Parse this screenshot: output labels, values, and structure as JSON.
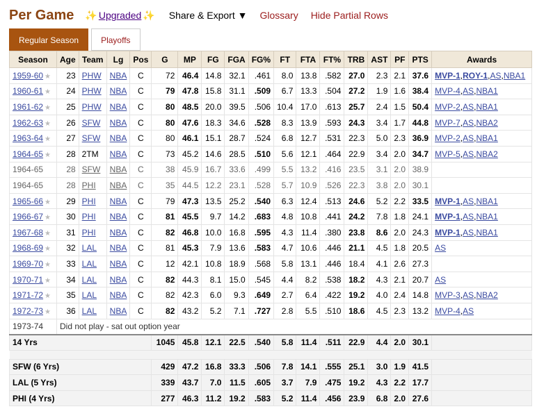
{
  "header": {
    "title": "Per Game",
    "upgraded": "Upgraded",
    "share_export": "Share & Export ▼",
    "glossary": "Glossary",
    "hide_partial": "Hide Partial Rows"
  },
  "tabs": [
    {
      "label": "Regular Season",
      "active": true
    },
    {
      "label": "Playoffs",
      "active": false
    }
  ],
  "columns": [
    "Season",
    "Age",
    "Team",
    "Lg",
    "Pos",
    "G",
    "MP",
    "FG",
    "FGA",
    "FG%",
    "FT",
    "FTA",
    "FT%",
    "TRB",
    "AST",
    "PF",
    "PTS",
    "Awards"
  ],
  "rows": [
    {
      "season": "1959-60",
      "age": "23",
      "team": "PHW",
      "team_link": true,
      "lg": "NBA",
      "pos": "C",
      "g": "72",
      "mp": "46.4",
      "fg": "14.8",
      "fga": "32.1",
      "fgp": "0.461",
      "ft": "8.0",
      "fta": "13.8",
      "ftp": "0.582",
      "trb": "27.0",
      "ast": "2.3",
      "pf": "2.1",
      "pts": "37.6",
      "bold": [
        "mp",
        "trb",
        "pts"
      ],
      "awards": [
        {
          "t": "MVP-1",
          "b": true
        },
        {
          "t": "ROY-1",
          "b": true
        },
        {
          "t": "AS"
        },
        {
          "t": "NBA1"
        }
      ]
    },
    {
      "season": "1960-61",
      "age": "24",
      "team": "PHW",
      "team_link": true,
      "lg": "NBA",
      "pos": "C",
      "g": "79",
      "mp": "47.8",
      "fg": "15.8",
      "fga": "31.1",
      "fgp": "0.509",
      "ft": "6.7",
      "fta": "13.3",
      "ftp": "0.504",
      "trb": "27.2",
      "ast": "1.9",
      "pf": "1.6",
      "pts": "38.4",
      "bold": [
        "g",
        "mp",
        "fgp",
        "trb",
        "pts"
      ],
      "awards": [
        {
          "t": "MVP-4"
        },
        {
          "t": "AS"
        },
        {
          "t": "NBA1"
        }
      ]
    },
    {
      "season": "1961-62",
      "age": "25",
      "team": "PHW",
      "team_link": true,
      "lg": "NBA",
      "pos": "C",
      "g": "80",
      "mp": "48.5",
      "fg": "20.0",
      "fga": "39.5",
      "fgp": "0.506",
      "ft": "10.4",
      "fta": "17.0",
      "ftp": "0.613",
      "trb": "25.7",
      "ast": "2.4",
      "pf": "1.5",
      "pts": "50.4",
      "bold": [
        "g",
        "mp",
        "trb",
        "pts"
      ],
      "awards": [
        {
          "t": "MVP-2"
        },
        {
          "t": "AS"
        },
        {
          "t": "NBA1"
        }
      ]
    },
    {
      "season": "1962-63",
      "age": "26",
      "team": "SFW",
      "team_link": true,
      "lg": "NBA",
      "pos": "C",
      "g": "80",
      "mp": "47.6",
      "fg": "18.3",
      "fga": "34.6",
      "fgp": "0.528",
      "ft": "8.3",
      "fta": "13.9",
      "ftp": "0.593",
      "trb": "24.3",
      "ast": "3.4",
      "pf": "1.7",
      "pts": "44.8",
      "bold": [
        "g",
        "mp",
        "fgp",
        "trb",
        "pts"
      ],
      "awards": [
        {
          "t": "MVP-7"
        },
        {
          "t": "AS"
        },
        {
          "t": "NBA2"
        }
      ]
    },
    {
      "season": "1963-64",
      "age": "27",
      "team": "SFW",
      "team_link": true,
      "lg": "NBA",
      "pos": "C",
      "g": "80",
      "mp": "46.1",
      "fg": "15.1",
      "fga": "28.7",
      "fgp": "0.524",
      "ft": "6.8",
      "fta": "12.7",
      "ftp": "0.531",
      "trb": "22.3",
      "ast": "5.0",
      "pf": "2.3",
      "pts": "36.9",
      "bold": [
        "mp",
        "pts"
      ],
      "awards": [
        {
          "t": "MVP-2"
        },
        {
          "t": "AS"
        },
        {
          "t": "NBA1"
        }
      ]
    },
    {
      "season": "1964-65",
      "age": "28",
      "team": "2TM",
      "team_link": false,
      "lg": "NBA",
      "pos": "C",
      "g": "73",
      "mp": "45.2",
      "fg": "14.6",
      "fga": "28.5",
      "fgp": "0.510",
      "ft": "5.6",
      "fta": "12.1",
      "ftp": "0.464",
      "trb": "22.9",
      "ast": "3.4",
      "pf": "2.0",
      "pts": "34.7",
      "bold": [
        "fgp",
        "pts"
      ],
      "awards": [
        {
          "t": "MVP-5"
        },
        {
          "t": "AS"
        },
        {
          "t": "NBA2"
        }
      ]
    },
    {
      "season": "1964-65",
      "partial": true,
      "age": "28",
      "team": "SFW",
      "team_link": true,
      "lg": "NBA",
      "pos": "C",
      "g": "38",
      "mp": "45.9",
      "fg": "16.7",
      "fga": "33.6",
      "fgp": "0.499",
      "ft": "5.5",
      "fta": "13.2",
      "ftp": "0.416",
      "trb": "23.5",
      "ast": "3.1",
      "pf": "2.0",
      "pts": "38.9",
      "bold": [],
      "awards": []
    },
    {
      "season": "1964-65",
      "partial": true,
      "age": "28",
      "team": "PHI",
      "team_link": true,
      "lg": "NBA",
      "pos": "C",
      "g": "35",
      "mp": "44.5",
      "fg": "12.2",
      "fga": "23.1",
      "fgp": "0.528",
      "ft": "5.7",
      "fta": "10.9",
      "ftp": "0.526",
      "trb": "22.3",
      "ast": "3.8",
      "pf": "2.0",
      "pts": "30.1",
      "bold": [],
      "awards": []
    },
    {
      "season": "1965-66",
      "age": "29",
      "team": "PHI",
      "team_link": true,
      "lg": "NBA",
      "pos": "C",
      "g": "79",
      "mp": "47.3",
      "fg": "13.5",
      "fga": "25.2",
      "fgp": "0.540",
      "ft": "6.3",
      "fta": "12.4",
      "ftp": "0.513",
      "trb": "24.6",
      "ast": "5.2",
      "pf": "2.2",
      "pts": "33.5",
      "bold": [
        "mp",
        "fgp",
        "trb",
        "pts"
      ],
      "awards": [
        {
          "t": "MVP-1",
          "b": true
        },
        {
          "t": "AS"
        },
        {
          "t": "NBA1"
        }
      ]
    },
    {
      "season": "1966-67",
      "age": "30",
      "team": "PHI",
      "team_link": true,
      "lg": "NBA",
      "pos": "C",
      "g": "81",
      "mp": "45.5",
      "fg": "9.7",
      "fga": "14.2",
      "fgp": "0.683",
      "ft": "4.8",
      "fta": "10.8",
      "ftp": "0.441",
      "trb": "24.2",
      "ast": "7.8",
      "pf": "1.8",
      "pts": "24.1",
      "bold": [
        "g",
        "mp",
        "fgp",
        "trb"
      ],
      "awards": [
        {
          "t": "MVP-1",
          "b": true
        },
        {
          "t": "AS"
        },
        {
          "t": "NBA1"
        }
      ]
    },
    {
      "season": "1967-68",
      "age": "31",
      "team": "PHI",
      "team_link": true,
      "lg": "NBA",
      "pos": "C",
      "g": "82",
      "mp": "46.8",
      "fg": "10.0",
      "fga": "16.8",
      "fgp": "0.595",
      "ft": "4.3",
      "fta": "11.4",
      "ftp": "0.380",
      "trb": "23.8",
      "ast": "8.6",
      "pf": "2.0",
      "pts": "24.3",
      "bold": [
        "g",
        "mp",
        "fgp",
        "trb",
        "ast"
      ],
      "awards": [
        {
          "t": "MVP-1",
          "b": true
        },
        {
          "t": "AS"
        },
        {
          "t": "NBA1"
        }
      ]
    },
    {
      "season": "1968-69",
      "age": "32",
      "team": "LAL",
      "team_link": true,
      "lg": "NBA",
      "pos": "C",
      "g": "81",
      "mp": "45.3",
      "fg": "7.9",
      "fga": "13.6",
      "fgp": "0.583",
      "ft": "4.7",
      "fta": "10.6",
      "ftp": "0.446",
      "trb": "21.1",
      "ast": "4.5",
      "pf": "1.8",
      "pts": "20.5",
      "bold": [
        "mp",
        "fgp",
        "trb"
      ],
      "awards": [
        {
          "t": "AS"
        }
      ]
    },
    {
      "season": "1969-70",
      "age": "33",
      "team": "LAL",
      "team_link": true,
      "lg": "NBA",
      "pos": "C",
      "g": "12",
      "mp": "42.1",
      "fg": "10.8",
      "fga": "18.9",
      "fgp": "0.568",
      "ft": "5.8",
      "fta": "13.1",
      "ftp": "0.446",
      "trb": "18.4",
      "ast": "4.1",
      "pf": "2.6",
      "pts": "27.3",
      "bold": [],
      "awards": []
    },
    {
      "season": "1970-71",
      "age": "34",
      "team": "LAL",
      "team_link": true,
      "lg": "NBA",
      "pos": "C",
      "g": "82",
      "mp": "44.3",
      "fg": "8.1",
      "fga": "15.0",
      "fgp": "0.545",
      "ft": "4.4",
      "fta": "8.2",
      "ftp": "0.538",
      "trb": "18.2",
      "ast": "4.3",
      "pf": "2.1",
      "pts": "20.7",
      "bold": [
        "g",
        "trb"
      ],
      "awards": [
        {
          "t": "AS"
        }
      ]
    },
    {
      "season": "1971-72",
      "age": "35",
      "team": "LAL",
      "team_link": true,
      "lg": "NBA",
      "pos": "C",
      "g": "82",
      "mp": "42.3",
      "fg": "6.0",
      "fga": "9.3",
      "fgp": "0.649",
      "ft": "2.7",
      "fta": "6.4",
      "ftp": "0.422",
      "trb": "19.2",
      "ast": "4.0",
      "pf": "2.4",
      "pts": "14.8",
      "bold": [
        "fgp",
        "trb"
      ],
      "awards": [
        {
          "t": "MVP-3"
        },
        {
          "t": "AS"
        },
        {
          "t": "NBA2"
        }
      ]
    },
    {
      "season": "1972-73",
      "age": "36",
      "team": "LAL",
      "team_link": true,
      "lg": "NBA",
      "pos": "C",
      "g": "82",
      "mp": "43.2",
      "fg": "5.2",
      "fga": "7.1",
      "fgp": "0.727",
      "ft": "2.8",
      "fta": "5.5",
      "ftp": "0.510",
      "trb": "18.6",
      "ast": "4.5",
      "pf": "2.3",
      "pts": "13.2",
      "bold": [
        "g",
        "fgp",
        "trb"
      ],
      "awards": [
        {
          "t": "MVP-4"
        },
        {
          "t": "AS"
        }
      ]
    }
  ],
  "did_not_play": {
    "season": "1973-74",
    "note": "Did not play - sat out option year"
  },
  "totals": {
    "label": "14 Yrs",
    "g": "1045",
    "mp": "45.8",
    "fg": "12.1",
    "fga": "22.5",
    "fgp": "0.540",
    "ft": "5.8",
    "fta": "11.4",
    "ftp": "0.511",
    "trb": "22.9",
    "ast": "4.4",
    "pf": "2.0",
    "pts": "30.1"
  },
  "teams": [
    {
      "label": "SFW (6 Yrs)",
      "g": "429",
      "mp": "47.2",
      "fg": "16.8",
      "fga": "33.3",
      "fgp": "0.506",
      "ft": "7.8",
      "fta": "14.1",
      "ftp": "0.555",
      "trb": "25.1",
      "ast": "3.0",
      "pf": "1.9",
      "pts": "41.5"
    },
    {
      "label": "LAL (5 Yrs)",
      "g": "339",
      "mp": "43.7",
      "fg": "7.0",
      "fga": "11.5",
      "fgp": "0.605",
      "ft": "3.7",
      "fta": "7.9",
      "ftp": "0.475",
      "trb": "19.2",
      "ast": "4.3",
      "pf": "2.2",
      "pts": "17.7"
    },
    {
      "label": "PHI (4 Yrs)",
      "g": "277",
      "mp": "46.3",
      "fg": "11.2",
      "fga": "19.2",
      "fgp": "0.583",
      "ft": "5.2",
      "fta": "11.4",
      "ftp": "0.456",
      "trb": "23.9",
      "ast": "6.8",
      "pf": "2.0",
      "pts": "27.6"
    }
  ],
  "colors": {
    "tab_active": "#a85410",
    "highlight": "#f6cf45",
    "title": "#8b4513",
    "link": "#3b4ba0"
  }
}
